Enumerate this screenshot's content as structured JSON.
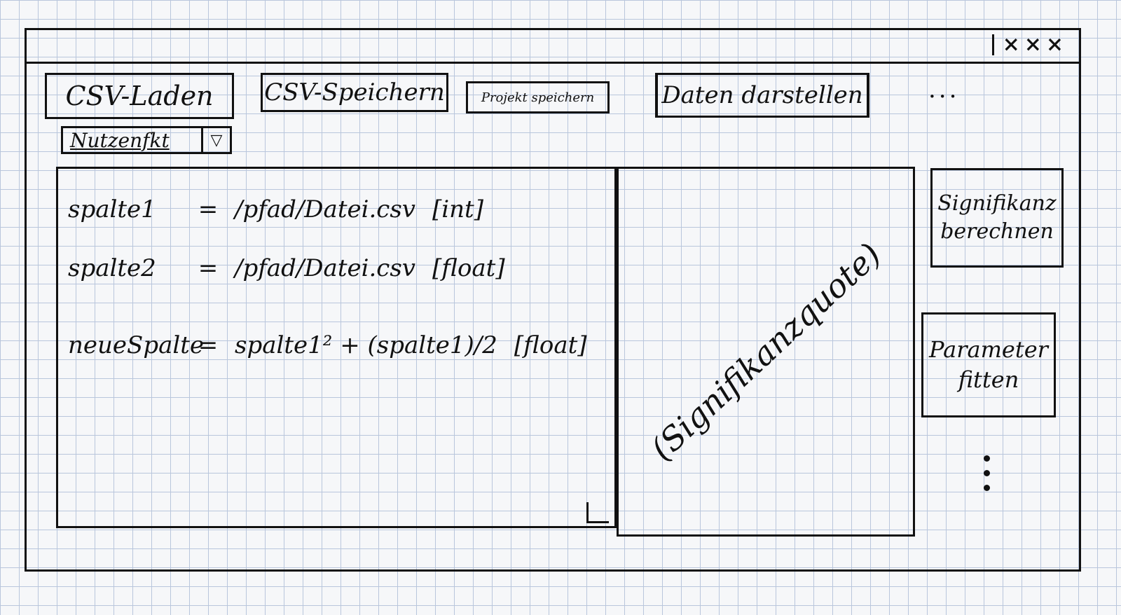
{
  "window": {
    "controls": [
      "×",
      "×",
      "×"
    ]
  },
  "toolbar": {
    "csv_load": "CSV-Laden",
    "csv_save": "CSV-Speichern",
    "project_save": "Projekt speichern",
    "plot_data": "Daten darstellen",
    "more": "..."
  },
  "function_dropdown": {
    "selected": "Nutzenfkt",
    "arrow": "▽"
  },
  "editor": {
    "lines": [
      {
        "var": "spalte1",
        "eq": "=",
        "expr": "/pfad/Datei.csv",
        "type": "[int]"
      },
      {
        "var": "spalte2",
        "eq": "=",
        "expr": "/pfad/Datei.csv",
        "type": "[float]"
      },
      {
        "var": "neueSpalte",
        "eq": "=",
        "expr": "spalte1² + (spalte1)/2",
        "type": "[float]"
      }
    ]
  },
  "preview": {
    "label": "(Signifikanzquote)"
  },
  "side_actions": {
    "significance": "Signifikanz berechnen",
    "fit": "Parameter fitten"
  }
}
